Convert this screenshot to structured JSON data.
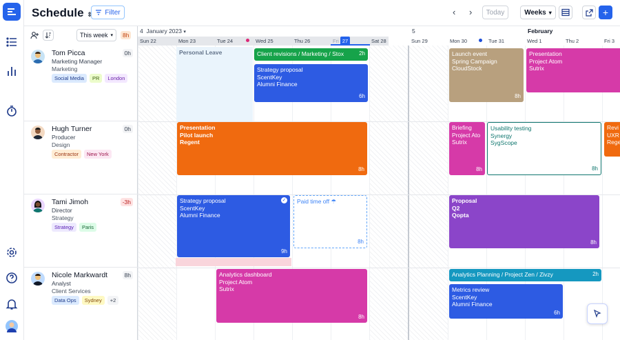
{
  "header": {
    "title": "Schedule",
    "filter_label": "Filter",
    "today_label": "Today",
    "view_label": "Weeks"
  },
  "toolbar": {
    "range_label": "This week",
    "range_hours": "8h"
  },
  "timeline": {
    "week1_num": "4",
    "week1_month": "January 2023",
    "week2_num": "5",
    "week2_month": "February",
    "days": [
      "Sun 22",
      "Mon 23",
      "Tue 24",
      "Wed 25",
      "Thu 26",
      "Fri",
      "27",
      "Sat 28",
      "Sun 29",
      "Mon 30",
      "Tue 31",
      "Wed 1",
      "Thu 2",
      "Fri 3"
    ]
  },
  "people": [
    {
      "name": "Tom Picca",
      "role": "Marketing Manager",
      "dept": "Marketing",
      "hours": "0h",
      "tags": [
        "Social Media",
        "PR",
        "London"
      ]
    },
    {
      "name": "Hugh Turner",
      "role": "Producer",
      "dept": "Design",
      "hours": "0h",
      "tags": [
        "Contractor",
        "New York"
      ]
    },
    {
      "name": "Tami Jimoh",
      "role": "Director",
      "dept": "Strategy",
      "hours": "-3h",
      "tags": [
        "Strategy",
        "Paris"
      ]
    },
    {
      "name": "Nicole Markwardt",
      "role": "Analyst",
      "dept": "Client Services",
      "hours": "8h",
      "tags": [
        "Data Ops",
        "Sydney",
        "+2"
      ]
    }
  ],
  "events": {
    "personal_leave": "Personal Leave",
    "client_rev": {
      "title": "Client revisions / Marketing / Stox",
      "hours": "2h"
    },
    "strategy1": {
      "t1": "Strategy proposal",
      "t2": "ScentKey",
      "t3": "Alumni Finance",
      "hours": "6h"
    },
    "launch": {
      "t1": "Launch event",
      "t2": "Spring Campaign",
      "t3": "CloudStock",
      "hours": "8h"
    },
    "presentation_tom": {
      "t1": "Presentation",
      "t2": "Project Atom",
      "t3": "Sutrix"
    },
    "pres_hugh": {
      "t1": "Presentation",
      "t2": "Pilot launch",
      "t3": "Regent",
      "hours": "8h"
    },
    "briefing": {
      "t1": "Briefing",
      "t2": "Project Ato",
      "t3": "Sutrix",
      "hours": "8h"
    },
    "usability": {
      "t1": "Usability testing",
      "t2": "Synergy",
      "t3": "SygScope",
      "hours": "8h"
    },
    "revi": {
      "t1": "Revi",
      "t2": "UXR",
      "t3": "Rege"
    },
    "strategy2": {
      "t1": "Strategy proposal",
      "t2": "ScentKey",
      "t3": "Alumni Finance",
      "hours": "9h"
    },
    "pto": {
      "t1": "Paid time off",
      "hours": "8h"
    },
    "proposal": {
      "t1": "Proposal",
      "t2": "Q2",
      "t3": "Qopta",
      "hours": "8h"
    },
    "analytics": {
      "t1": "Analytics dashboard",
      "t2": "Project Atom",
      "t3": "Sutrix",
      "hours": "8h"
    },
    "analytics_plan": {
      "title": "Analytics Planning / Project Zen / Zivzy",
      "hours": "2h"
    },
    "metrics": {
      "t1": "Metrics review",
      "t2": "ScentKey",
      "t3": "Alumni Finance",
      "hours": "6h"
    }
  },
  "colors": {
    "blue": "#2d5be3",
    "green": "#16a34a",
    "orange": "#f06a0f",
    "taupe": "#b8a07e",
    "magenta": "#d63aa8",
    "purple": "#8b45c9",
    "teal": "#1598c0"
  }
}
